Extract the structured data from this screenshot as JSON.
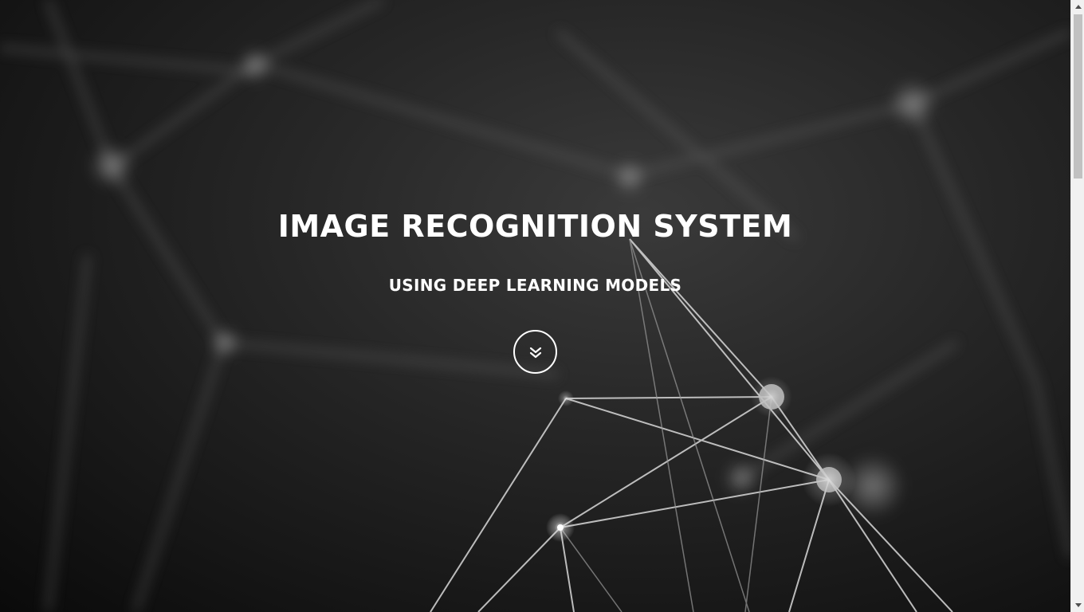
{
  "hero": {
    "title": "IMAGE RECOGNITION SYSTEM",
    "subtitle": "USING DEEP LEARNING MODELS",
    "scroll_icon": "double-chevron-down-icon"
  },
  "colors": {
    "text": "#ffffff",
    "background": "#1e1e1e",
    "scrollbar_track": "#f1f1f1",
    "scrollbar_thumb": "#c1c1c1"
  }
}
